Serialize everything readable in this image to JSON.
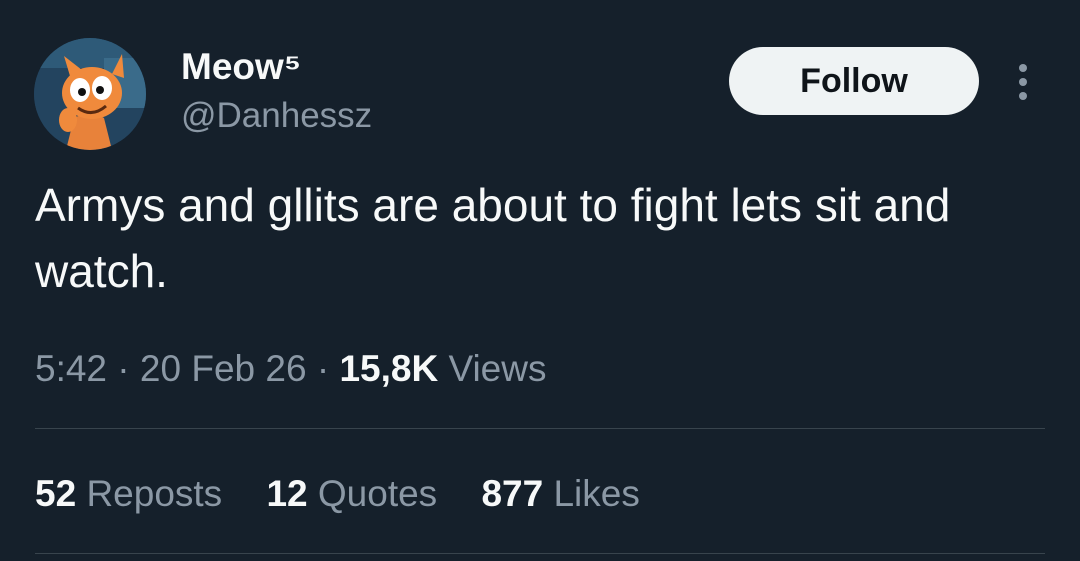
{
  "author": {
    "display_name": "Meow⁵",
    "handle": "@Danhessz",
    "avatar_icon": "cartoon-cat-avatar"
  },
  "actions": {
    "follow_label": "Follow",
    "more_icon": "more-vertical-icon"
  },
  "tweet": {
    "text": "Armys and gllits are about to fight lets sit and watch."
  },
  "meta": {
    "time": "5:42",
    "separator": "·",
    "date": "20 Feb 26",
    "views_count": "15,8K",
    "views_label": "Views"
  },
  "stats": {
    "reposts_count": "52",
    "reposts_label": "Reposts",
    "quotes_count": "12",
    "quotes_label": "Quotes",
    "likes_count": "877",
    "likes_label": "Likes"
  },
  "colors": {
    "background": "#15202b",
    "primary_text": "#f7f9f9",
    "secondary_text": "#8b98a5",
    "divider": "#38444d",
    "follow_button_bg": "#eff3f4"
  }
}
